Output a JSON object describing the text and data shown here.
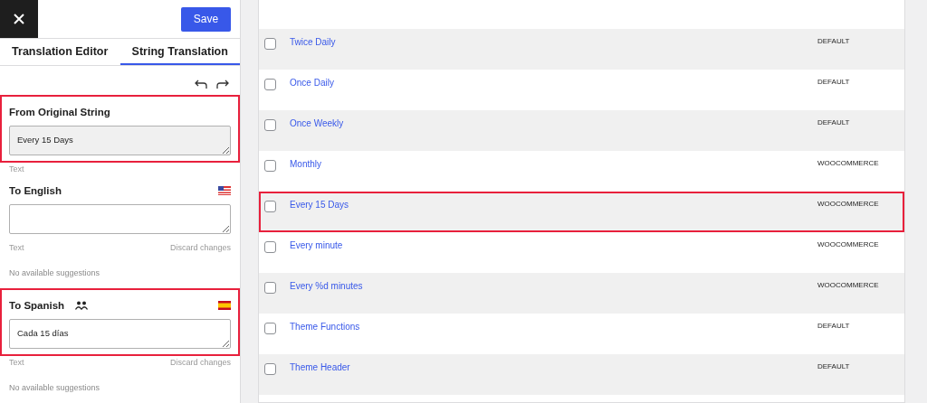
{
  "header": {
    "save_label": "Save"
  },
  "tabs": [
    {
      "label": "Translation Editor",
      "selected": false
    },
    {
      "label": "String Translation",
      "selected": true
    }
  ],
  "sections": [
    {
      "kind": "original",
      "title": "From Original String",
      "value": "Every 15 Days",
      "highlighted": true,
      "footer_left": "Text"
    },
    {
      "kind": "english",
      "title": "To English",
      "highlighted": false,
      "footer_left": "Text",
      "footer_right": "Discard changes",
      "suggestions": "No available suggestions"
    },
    {
      "kind": "spanish",
      "title": "To Spanish",
      "shared": true,
      "value": "Cada 15 días",
      "highlighted": true,
      "footer_left": "Text",
      "footer_right": "Discard changes",
      "suggestions": "No available suggestions"
    }
  ],
  "table": {
    "rows": [
      {
        "name": "Twice Daily",
        "domain": "DEFAULT",
        "checked": false,
        "highlighted": false
      },
      {
        "name": "Once Daily",
        "domain": "DEFAULT",
        "checked": false,
        "highlighted": false
      },
      {
        "name": "Once Weekly",
        "domain": "DEFAULT",
        "checked": false,
        "highlighted": false
      },
      {
        "name": "Monthly",
        "domain": "WOOCOMMERCE",
        "checked": false,
        "highlighted": false
      },
      {
        "name": "Every 15 Days",
        "domain": "WOOCOMMERCE",
        "checked": false,
        "highlighted": true
      },
      {
        "name": "Every minute",
        "domain": "WOOCOMMERCE",
        "checked": false,
        "highlighted": false
      },
      {
        "name": "Every %d minutes",
        "domain": "WOOCOMMERCE",
        "checked": false,
        "highlighted": false
      },
      {
        "name": "Theme Functions",
        "domain": "DEFAULT",
        "checked": false,
        "highlighted": false
      },
      {
        "name": "Theme Header",
        "domain": "DEFAULT",
        "checked": false,
        "highlighted": false
      }
    ]
  }
}
